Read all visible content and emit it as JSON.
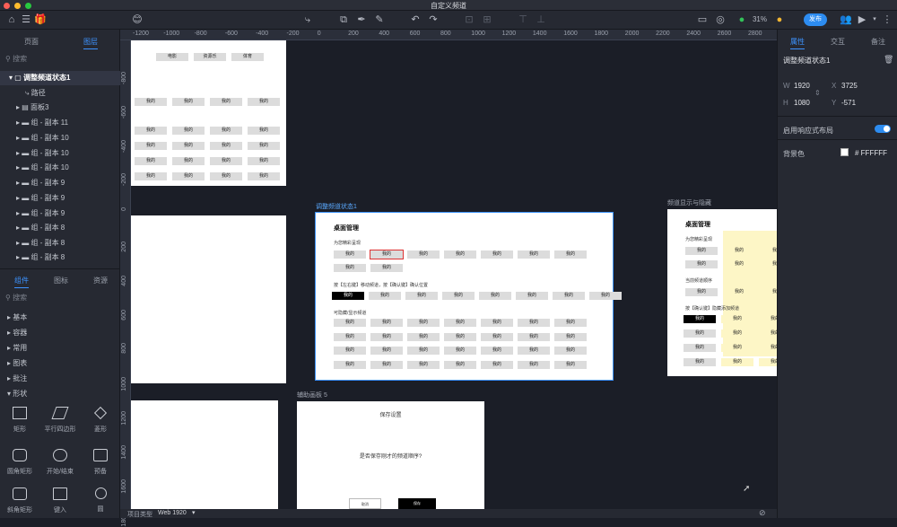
{
  "window": {
    "title": "自定义频道"
  },
  "toolbar": {
    "zoom": "31%",
    "publish": "发布"
  },
  "left": {
    "tabs": [
      "页面",
      "图层"
    ],
    "search_placeholder": "搜索",
    "layers": [
      {
        "label": "调整频道状态1",
        "selected": true
      },
      {
        "label": "路径"
      },
      {
        "label": "面板3"
      },
      {
        "label": "组 - 副本 11"
      },
      {
        "label": "组 - 副本 10"
      },
      {
        "label": "组 - 副本 10"
      },
      {
        "label": "组 - 副本 10"
      },
      {
        "label": "组 - 副本 9"
      },
      {
        "label": "组 - 副本 9"
      },
      {
        "label": "组 - 副本 9"
      },
      {
        "label": "组 - 副本 8"
      },
      {
        "label": "组 - 副本 8"
      },
      {
        "label": "组 - 副本 8"
      }
    ],
    "lib_tabs": [
      "组件",
      "图标",
      "资源"
    ],
    "lib_search": "搜索",
    "categories": [
      "基本",
      "容器",
      "常用",
      "图表",
      "批注",
      "形状"
    ],
    "shapes": [
      "矩形",
      "平行四边形",
      "菱形",
      "圆角矩形",
      "开始/结束",
      "预备",
      "斜角矩形",
      "键入",
      "圆"
    ]
  },
  "right": {
    "tabs": [
      "属性",
      "交互",
      "备注"
    ],
    "name": "调整频道状态1",
    "w_label": "W",
    "w": "1920",
    "x_label": "X",
    "x": "3725",
    "h_label": "H",
    "h": "1080",
    "y_label": "Y",
    "y": "-571",
    "responsive": "启用响应式布局",
    "bg_label": "背景色",
    "bg_value": "# FFFFFF"
  },
  "ruler": {
    "top": [
      "-1200",
      "-1000",
      "-800",
      "-600",
      "-400",
      "-200",
      "0",
      "200",
      "400",
      "600",
      "800",
      "1000",
      "1200",
      "1400",
      "1600",
      "1800",
      "2000",
      "2200",
      "2400",
      "2600",
      "2800"
    ],
    "left": [
      "-800",
      "-600",
      "-400",
      "-200",
      "0",
      "200",
      "400",
      "600",
      "800",
      "1000",
      "1200",
      "1400",
      "1600",
      "1800"
    ]
  },
  "canvas": {
    "label_main": "调整频道状态1",
    "label_right": "频道显示与隐藏",
    "label_dialog": "辅助画板 5",
    "title": "桌面管理",
    "sec1": "为您精彩呈现",
    "sec2": "按【左右键】移动频道，按【确认键】确认位置",
    "sec3": "可隐藏/显示频道",
    "sec_r1": "为您精彩呈现",
    "sec_r2": "当前频道顺序",
    "sec_r3": "按【确认键】隐藏添加频道",
    "chip": "我的",
    "top_chips": [
      "电影",
      "资源乐",
      "体育"
    ],
    "dialog_title": "保存设置",
    "dialog_msg": "是否保存刚才的频道顺序?",
    "dialog_cancel": "取消",
    "dialog_ok": "保存"
  },
  "bottom": {
    "label": "项目类型",
    "value": "Web 1920"
  }
}
